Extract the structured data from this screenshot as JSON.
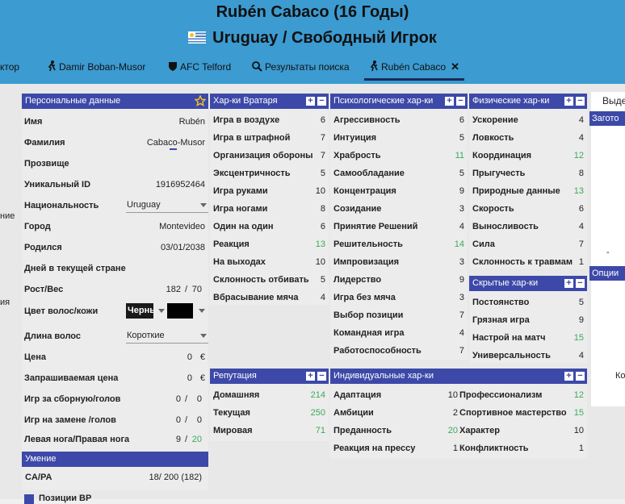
{
  "title": "Rubén Cabaco (16 Годы)",
  "subtitle": "Uruguay / Свободный Игрок",
  "tabs": [
    {
      "label": "ктор"
    },
    {
      "label": "Damir Boban-Musor"
    },
    {
      "label": "AFC Telford"
    },
    {
      "label": "Результаты поиска"
    },
    {
      "label": "Rubén Cabaco"
    }
  ],
  "personal": {
    "header": "Персональные данные",
    "rows": [
      {
        "label": "Имя",
        "value": "Rubén"
      },
      {
        "label": "Фамилия",
        "value": "Cabaco-Musor"
      },
      {
        "label": "Прозвище",
        "value": ""
      },
      {
        "label": "Уникальный ID",
        "value": "1916952464"
      },
      {
        "label": "Национальность",
        "value": "Uruguay"
      },
      {
        "label": "Город",
        "value": "Montevideo"
      },
      {
        "label": "Родился",
        "value": "03/01/2038"
      },
      {
        "label": "Дней в текущей стране",
        "value": ""
      },
      {
        "label": "Рост/Вес",
        "value": "182",
        "value2": "70"
      },
      {
        "label": "Цвет волос/кожи",
        "value": "Черны",
        "value2": ""
      },
      {
        "label": "Длина волос",
        "value": "Короткие"
      },
      {
        "label": "Цена",
        "value": "0",
        "unit": "€"
      },
      {
        "label": "Запрашиваемая цена",
        "value": "0",
        "unit": "€"
      },
      {
        "label": "Игр за сборную/голов",
        "value": "0",
        "value2": "0"
      },
      {
        "label": "Игр на замене /голов",
        "value": "0",
        "value2": "0"
      },
      {
        "label": "Левая нога/Правая нога",
        "value": "9",
        "value2": "20"
      }
    ]
  },
  "ability": {
    "header": "Умение",
    "label": "CA/PA",
    "ca": "18",
    "pa": "200",
    "extra": "(182)"
  },
  "goalkeeper": {
    "header": "Хар-ки Вратаря",
    "rows": [
      {
        "label": "Игра в воздухе",
        "value": "6"
      },
      {
        "label": "Игра в штрафной",
        "value": "7"
      },
      {
        "label": "Организация обороны",
        "value": "7"
      },
      {
        "label": "Эксцентричность",
        "value": "5"
      },
      {
        "label": "Игра руками",
        "value": "10"
      },
      {
        "label": "Игра ногами",
        "value": "8"
      },
      {
        "label": "Один на один",
        "value": "6"
      },
      {
        "label": "Реакция",
        "value": "13"
      },
      {
        "label": "На выходах",
        "value": "10"
      },
      {
        "label": "Склонность отбивать",
        "value": "5"
      },
      {
        "label": "Вбрасывание мяча",
        "value": "4"
      }
    ]
  },
  "mental": {
    "header": "Психологические хар-ки",
    "rows": [
      {
        "label": "Агрессивность",
        "value": "6"
      },
      {
        "label": "Интуиция",
        "value": "5"
      },
      {
        "label": "Храбрость",
        "value": "11"
      },
      {
        "label": "Самообладание",
        "value": "5"
      },
      {
        "label": "Концентрация",
        "value": "9"
      },
      {
        "label": "Созидание",
        "value": "3"
      },
      {
        "label": "Принятие Решений",
        "value": "4"
      },
      {
        "label": "Решительность",
        "value": "14"
      },
      {
        "label": "Импровизация",
        "value": "3"
      },
      {
        "label": "Лидерство",
        "value": "9"
      },
      {
        "label": "Игра без мяча",
        "value": "3"
      },
      {
        "label": "Выбор позиции",
        "value": "7"
      },
      {
        "label": "Командная игра",
        "value": "4"
      },
      {
        "label": "Работоспособность",
        "value": "7"
      }
    ]
  },
  "physical": {
    "header": "Физические хар-ки",
    "rows": [
      {
        "label": "Ускорение",
        "value": "4"
      },
      {
        "label": "Ловкость",
        "value": "4"
      },
      {
        "label": "Координация",
        "value": "12"
      },
      {
        "label": "Прыгучесть",
        "value": "8"
      },
      {
        "label": "Природные данные",
        "value": "13"
      },
      {
        "label": "Скорость",
        "value": "6"
      },
      {
        "label": "Выносливость",
        "value": "4"
      },
      {
        "label": "Сила",
        "value": "7"
      },
      {
        "label": "Склонность к травмам",
        "value": "1"
      }
    ]
  },
  "hidden": {
    "header": "Скрытые хар-ки",
    "rows": [
      {
        "label": "Постоянство",
        "value": "5"
      },
      {
        "label": "Грязная игра",
        "value": "9"
      },
      {
        "label": "Настрой на матч",
        "value": "15"
      },
      {
        "label": "Универсальность",
        "value": "4"
      }
    ]
  },
  "reputation": {
    "header": "Репутация",
    "rows": [
      {
        "label": "Домашняя",
        "value": "214"
      },
      {
        "label": "Текущая",
        "value": "250"
      },
      {
        "label": "Мировая",
        "value": "71"
      }
    ]
  },
  "individual": {
    "header": "Индивидуальные хар-ки",
    "rows": [
      {
        "label": "Адаптация",
        "value": "10"
      },
      {
        "label": "Амбиции",
        "value": "2"
      },
      {
        "label": "Преданность",
        "value": "20"
      },
      {
        "label": "Реакция на прессу",
        "value": "1"
      },
      {
        "label": "Профессионализм",
        "value": "12"
      },
      {
        "label": "Спортивное мастерство",
        "value": "15"
      },
      {
        "label": "Характер",
        "value": "10"
      },
      {
        "label": "Конфликтность",
        "value": "1"
      }
    ]
  },
  "right_side": {
    "vyde": "Выде",
    "zagot": "Загото",
    "dash": "-",
    "options": "Опции",
    "ko": "Ко"
  },
  "left_edge": {
    "a": "ние",
    "b": "ия"
  },
  "bottom_check": "Позиции ВР",
  "colors": {
    "header_bg": "#3c9bd1",
    "panel_head": "#3d49a8",
    "good": "#3aaa5a"
  }
}
